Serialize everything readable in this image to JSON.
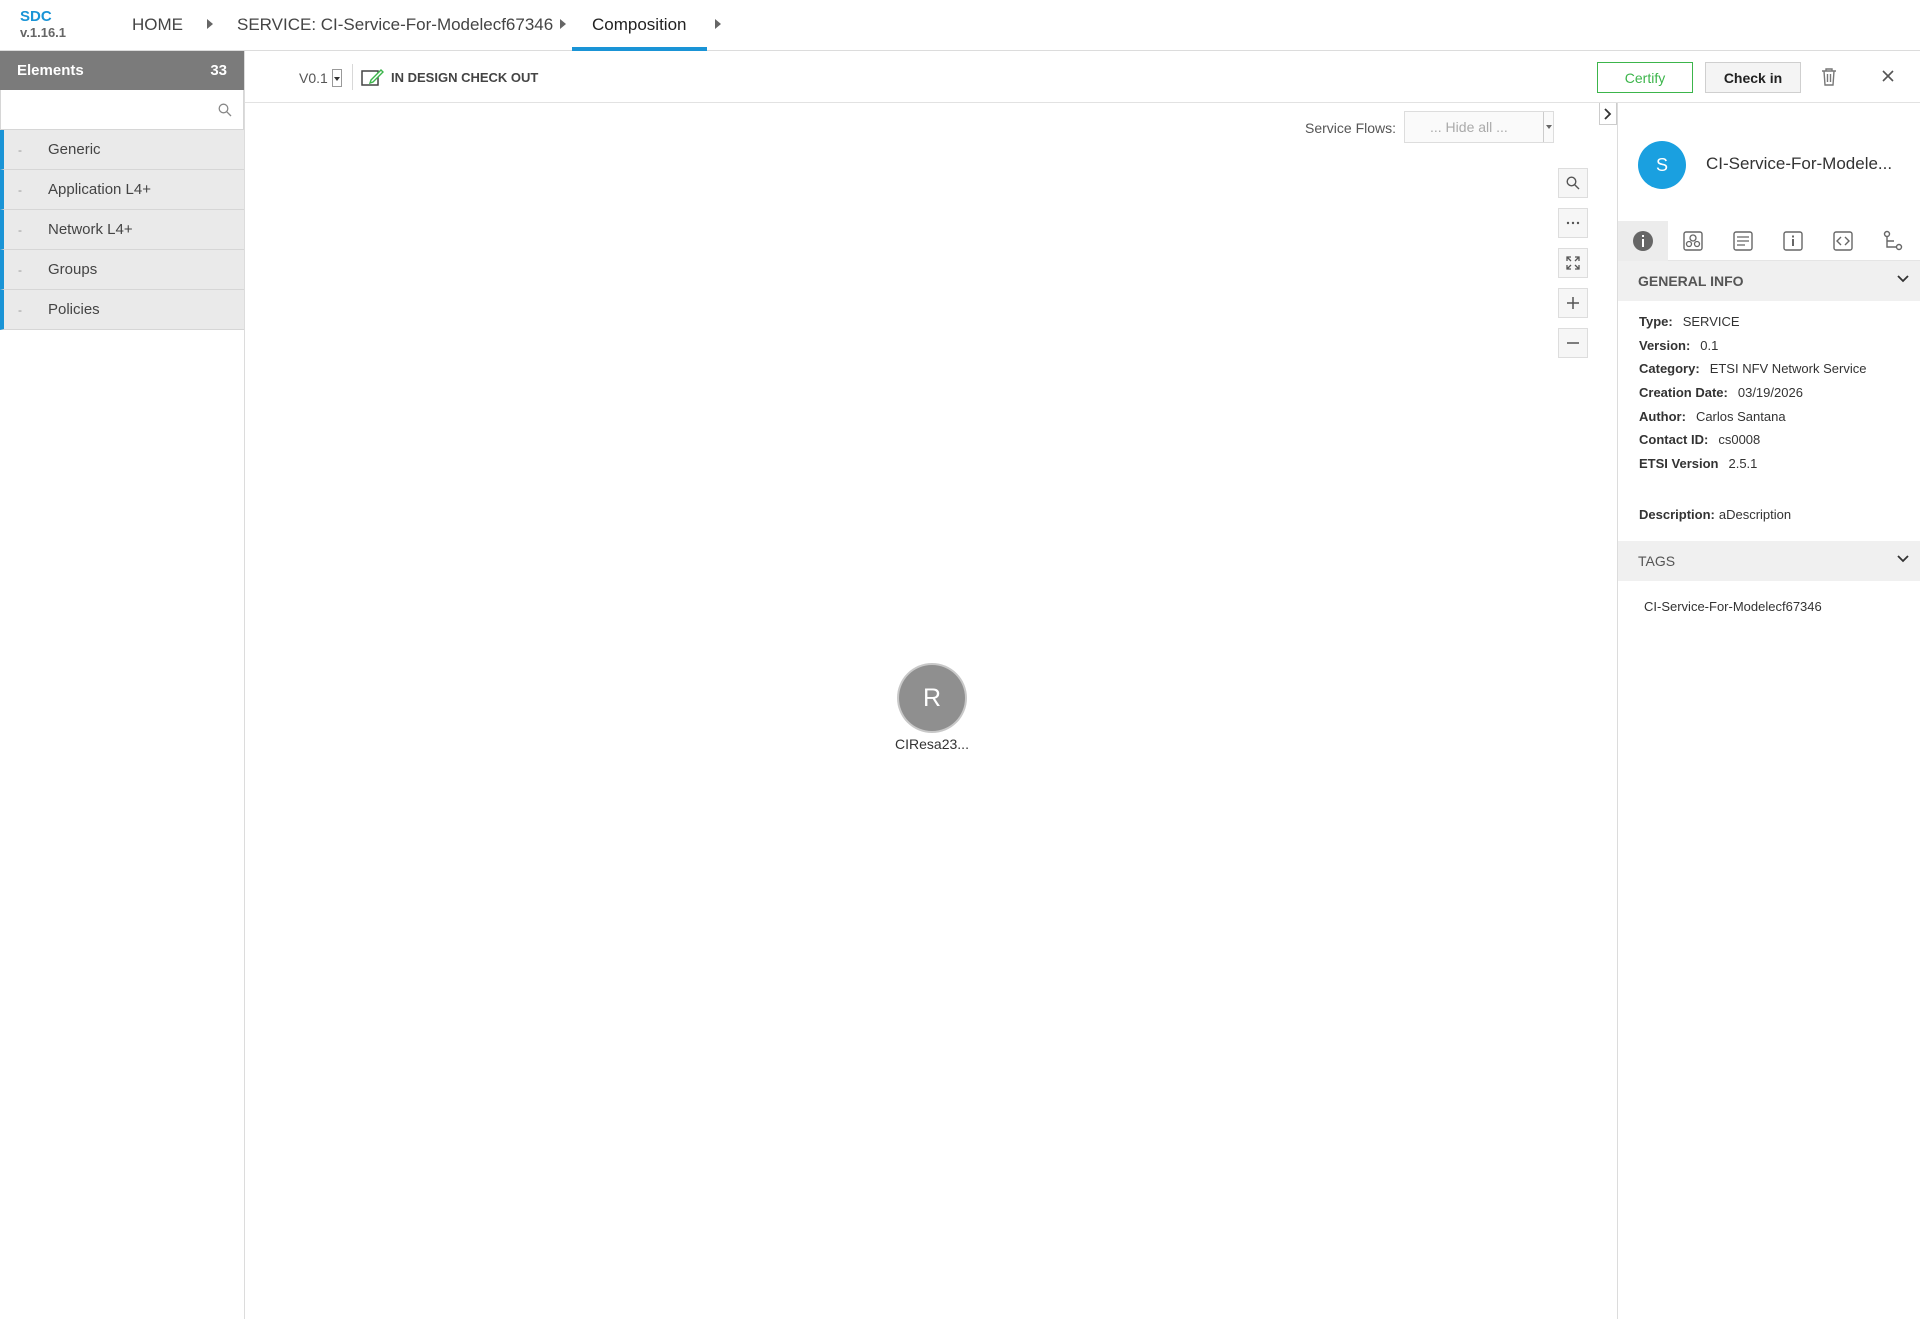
{
  "app": {
    "name": "SDC",
    "version": "v.1.16.1"
  },
  "breadcrumbs": [
    {
      "label": "HOME"
    },
    {
      "label": "SERVICE: CI-Service-For-Modelecf67346"
    },
    {
      "label": "Composition"
    }
  ],
  "sidebar": {
    "title": "Elements",
    "count": "33",
    "search_placeholder": "",
    "items": [
      {
        "label": "Generic"
      },
      {
        "label": "Application L4+"
      },
      {
        "label": "Network L4+"
      },
      {
        "label": "Groups"
      },
      {
        "label": "Policies"
      }
    ]
  },
  "toolbar": {
    "version": "V0.1",
    "status": "IN DESIGN CHECK OUT",
    "certify_label": "Certify",
    "checkin_label": "Check in"
  },
  "canvas": {
    "flows_label": "Service Flows:",
    "flows_value": "... Hide all ...",
    "node": {
      "initial": "R",
      "label": "CIResa23..."
    }
  },
  "panel": {
    "avatar_initial": "S",
    "title": "CI-Service-For-Modele...",
    "general_info_title": "GENERAL INFO",
    "info": [
      {
        "key": "Type:",
        "value": "SERVICE"
      },
      {
        "key": "Version:",
        "value": "0.1"
      },
      {
        "key": "Category:",
        "value": "ETSI NFV Network Service"
      },
      {
        "key": "Creation Date:",
        "value": "03/19/2026"
      },
      {
        "key": "Author:",
        "value": "Carlos Santana"
      },
      {
        "key": "Contact ID:",
        "value": "cs0008"
      },
      {
        "key": "ETSI Version",
        "value": "2.5.1"
      }
    ],
    "description_key": "Description:",
    "description_value": "aDescription",
    "tags_title": "TAGS",
    "tags": [
      "CI-Service-For-Modelecf67346"
    ]
  },
  "colors": {
    "accent": "#1a94d6",
    "certify": "#3cb54b",
    "avatar": "#1aa0e0",
    "node": "#8f8f8f"
  }
}
